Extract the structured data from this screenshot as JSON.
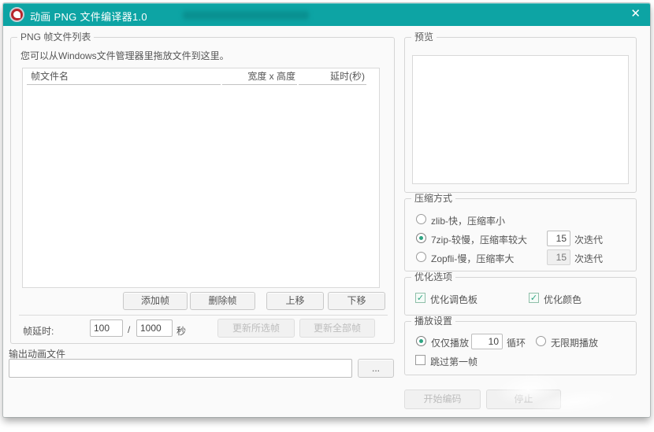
{
  "titlebar": {
    "title": "动画 PNG 文件编译器1.0",
    "close_glyph": "✕"
  },
  "frame_list": {
    "group_title": "PNG 帧文件列表",
    "hint": "您可以从Windows文件管理器里拖放文件到这里。",
    "columns": {
      "name": "帧文件名",
      "size": "宽度 x 高度",
      "delay": "延时(秒)"
    },
    "rows": [],
    "buttons": {
      "add": "添加帧",
      "remove": "删除帧",
      "move_up": "上移",
      "move_down": "下移"
    },
    "delay_row": {
      "label": "帧延时:",
      "numerator": "100",
      "separator": "/",
      "denominator": "1000",
      "unit": "秒",
      "update_selected": "更新所选帧",
      "update_all": "更新全部帧"
    }
  },
  "output": {
    "label": "输出动画文件",
    "path_value": "",
    "browse": "..."
  },
  "preview": {
    "group_title": "预览"
  },
  "compression": {
    "group_title": "压缩方式",
    "zlib_label": "zlib-快，压缩率小",
    "sevenzip_label": "7zip-较慢，压缩率较大",
    "sevenzip_iterations": "15",
    "zopfli_label": "Zopfli-慢，压缩率大",
    "zopfli_iterations": "15",
    "iterations_unit": "次迭代"
  },
  "optimization": {
    "group_title": "优化选项",
    "palette_label": "优化调色板",
    "color_label": "优化颜色"
  },
  "playback": {
    "group_title": "播放设置",
    "play_count_label": "仅仅播放",
    "loop_count": "10",
    "loop_unit": "循环",
    "infinite_label": "无限期播放",
    "skip_first_label": "跳过第一帧"
  },
  "actions": {
    "start": "开始编码",
    "stop": "停止"
  },
  "colors": {
    "titlebar_teal": "#0DA4A4",
    "accent_green": "#2EA482"
  }
}
